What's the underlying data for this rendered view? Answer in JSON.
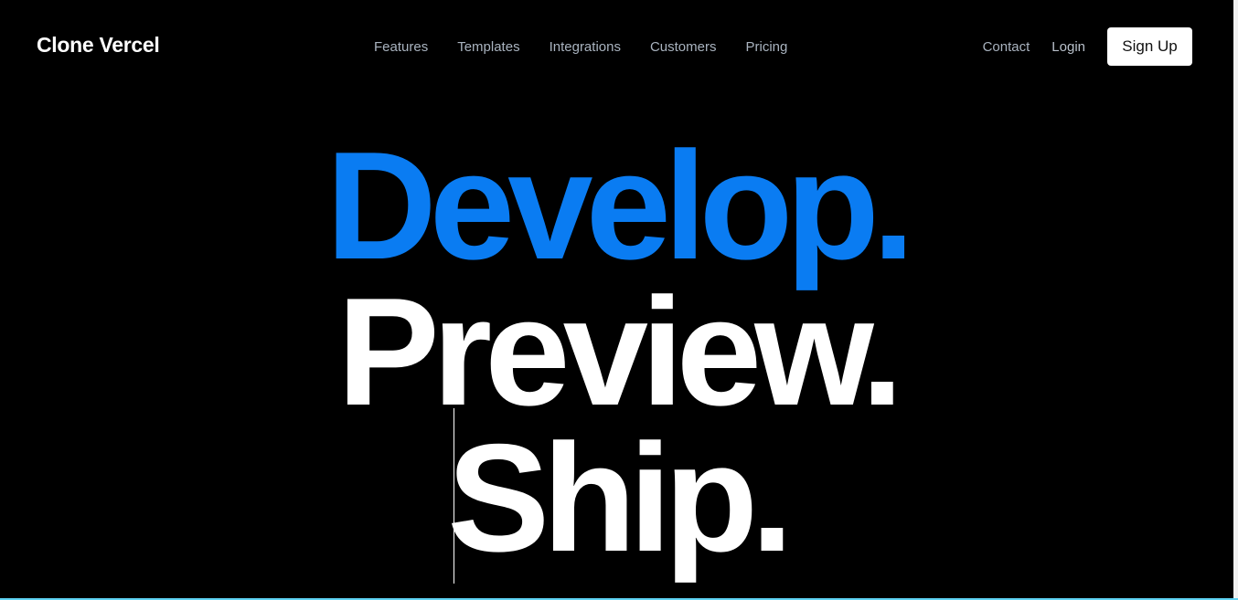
{
  "brand": {
    "name": "Clone Vercel"
  },
  "nav": {
    "center": [
      {
        "label": "Features"
      },
      {
        "label": "Templates"
      },
      {
        "label": "Integrations"
      },
      {
        "label": "Customers"
      },
      {
        "label": "Pricing"
      }
    ],
    "contact_label": "Contact",
    "login_label": "Login",
    "signup_label": "Sign Up"
  },
  "hero": {
    "line1": "Develop.",
    "line2": "Preview.",
    "line3": "Ship."
  },
  "colors": {
    "background": "#000000",
    "accent": "#0a7cf2",
    "nav_text": "#a9b3bf",
    "button_bg": "#ffffff"
  }
}
